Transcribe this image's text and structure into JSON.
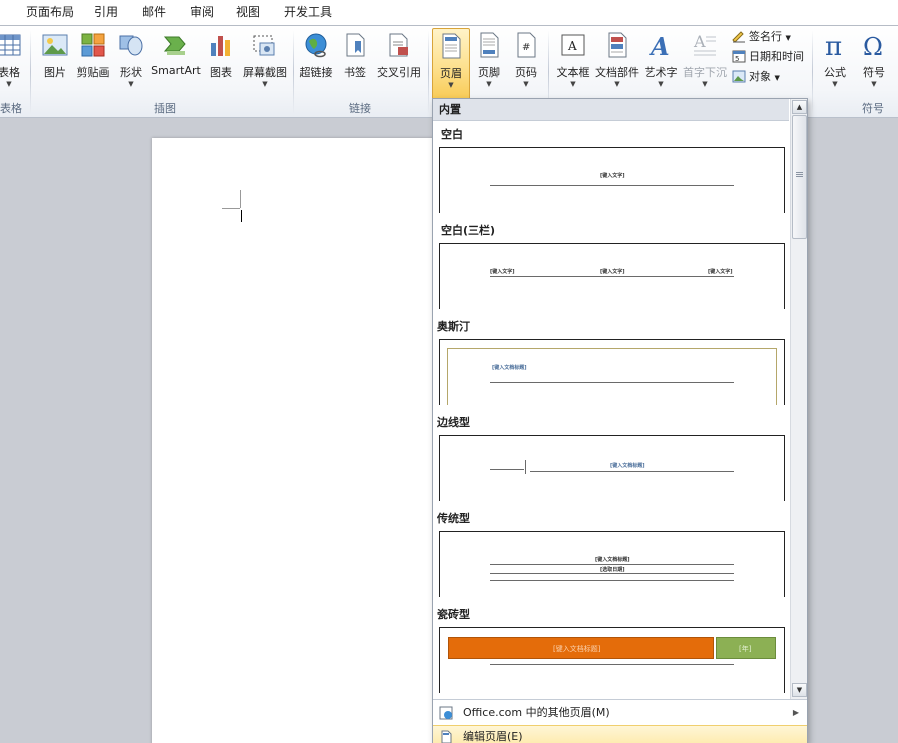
{
  "tabs": [
    "页面布局",
    "引用",
    "邮件",
    "审阅",
    "视图",
    "开发工具"
  ],
  "ribbon": {
    "table_label": "表格",
    "pictures_label": "图片",
    "clipart_label": "剪贴画",
    "shapes_label": "形状",
    "smartart_label": "SmartArt",
    "chart_label": "图表",
    "screenshot_label": "屏幕截图",
    "hyperlink_label": "超链接",
    "bookmark_label": "书签",
    "crossref_label": "交叉引用",
    "header_label": "页眉",
    "footer_label": "页脚",
    "pagenum_label": "页码",
    "textbox_label": "文本框",
    "quickparts_label": "文档部件",
    "wordart_label": "艺术字",
    "dropcap_label": "首字下沉",
    "signature_label": "签名行",
    "datetime_label": "日期和时间",
    "object_label": "对象",
    "equation_label": "公式",
    "symbol_label": "符号",
    "groups": {
      "table": "表格",
      "illustrations": "插图",
      "links": "链接",
      "symbols": "符号"
    }
  },
  "gallery": {
    "section": "内置",
    "items": [
      {
        "title": "空白",
        "placeholders": [
          "[键入文字]"
        ]
      },
      {
        "title": "空白(三栏)",
        "placeholders": [
          "[键入文字]",
          "[键入文字]",
          "[键入文字]"
        ]
      },
      {
        "title": "奥斯汀",
        "placeholders": [
          "[键入文档标题]"
        ]
      },
      {
        "title": "边线型",
        "placeholders": [
          "[键入文档标题]"
        ]
      },
      {
        "title": "传统型",
        "placeholders": [
          "[键入文档标题]",
          "[选取日期]"
        ]
      },
      {
        "title": "瓷砖型",
        "placeholders": [
          "[键入文档标题]",
          "[年]"
        ]
      }
    ],
    "more_label": "Office.com 中的其他页眉(M)",
    "edit_label": "编辑页眉(E)"
  },
  "colors": {
    "accent_active": "#f8cb56",
    "tile_orange": "#e46c0a",
    "tile_green": "#8cb054"
  }
}
